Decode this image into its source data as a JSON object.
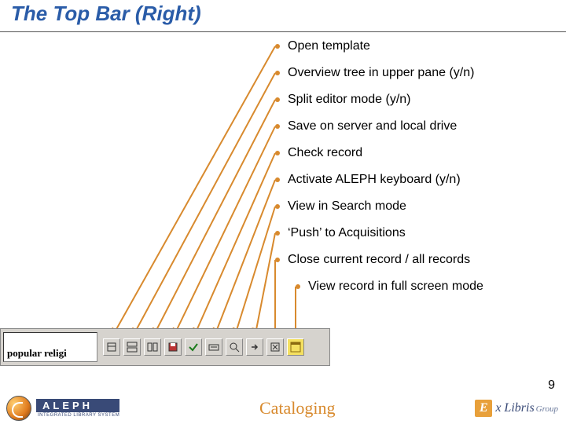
{
  "slide": {
    "title": "The Top Bar (Right)",
    "page_number": "9"
  },
  "bullets": {
    "b0": "Open template",
    "b1": "Overview tree in upper pane (y/n)",
    "b2": "Split editor mode (y/n)",
    "b3": "Save on server and local drive",
    "b4": "Check record",
    "b5": "Activate ALEPH keyboard (y/n)",
    "b6": "View in Search mode",
    "b7": "‘Push’ to Acquisitions",
    "b8": "Close current record / all records",
    "b9": "View record in full screen mode"
  },
  "toolbar": {
    "search_value": "popular religi"
  },
  "footer": {
    "aleph_name": "ALEPH",
    "aleph_sub": "INTEGRATED LIBRARY SYSTEM",
    "center": "Cataloging",
    "exlibris_e": "E",
    "exlibris_text": "x Libris",
    "exlibris_group": "Group"
  },
  "colors": {
    "brand_blue": "#2a5ca8",
    "accent_orange": "#d88a2e"
  }
}
